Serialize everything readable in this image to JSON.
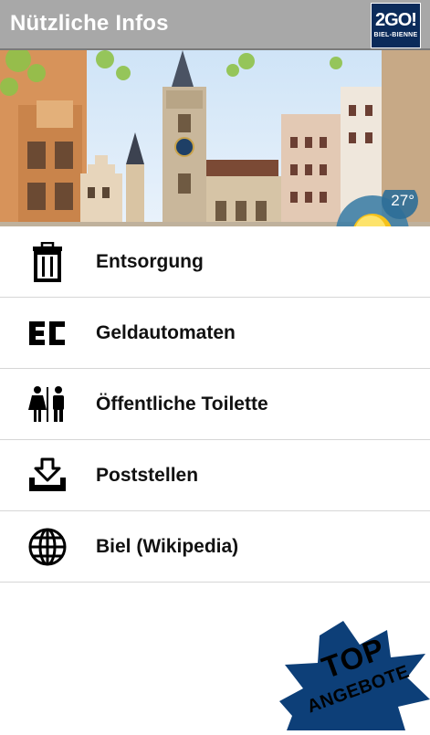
{
  "header": {
    "title": "Nützliche Infos",
    "logo_main": "2GO!",
    "logo_sub": "BIEL-BIENNE"
  },
  "weather": {
    "temperature": "27°",
    "icon": "sun-icon"
  },
  "menu": {
    "items": [
      {
        "label": "Entsorgung",
        "icon": "trash-can-icon"
      },
      {
        "label": "Geldautomaten",
        "icon": "ec-logo-icon"
      },
      {
        "label": "Öffentliche Toilette",
        "icon": "toilet-people-icon"
      },
      {
        "label": "Poststellen",
        "icon": "inbox-download-icon"
      },
      {
        "label": "Biel (Wikipedia)",
        "icon": "globe-icon"
      }
    ]
  },
  "badge": {
    "line1": "TOP",
    "line2": "ANGEBOTE"
  },
  "colors": {
    "header_bg": "#a8a8a8",
    "logo_bg": "#0b2b5a",
    "badge_bg": "#0d3f78"
  }
}
